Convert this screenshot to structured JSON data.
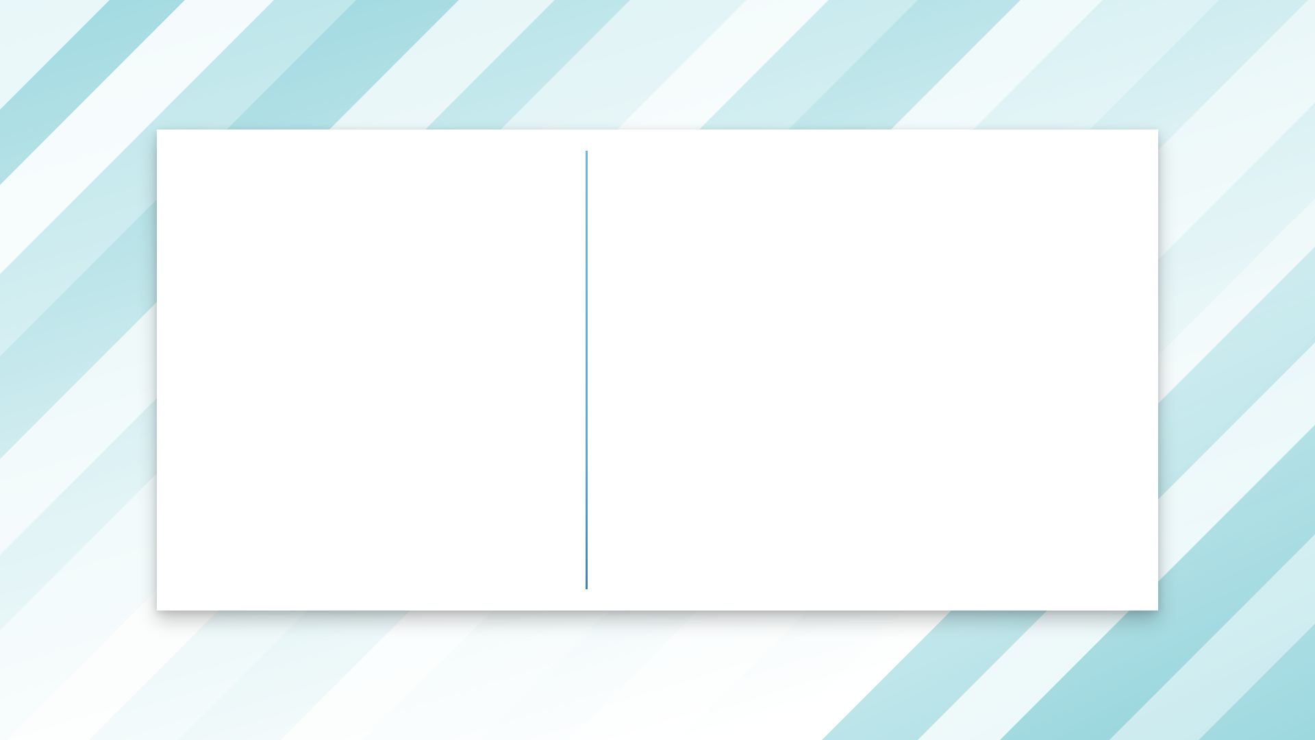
{
  "background": {
    "style": "diagonal-stripes",
    "colors": {
      "base": "#ffffff",
      "stripe_light": "#e6f5f7",
      "stripe_mid": "#bfe6eb",
      "stripe_dark": "#93d6de"
    }
  },
  "card": {
    "background_color": "#ffffff",
    "divider_color": "#5aa6e2",
    "left_pane": {},
    "right_pane": {}
  }
}
